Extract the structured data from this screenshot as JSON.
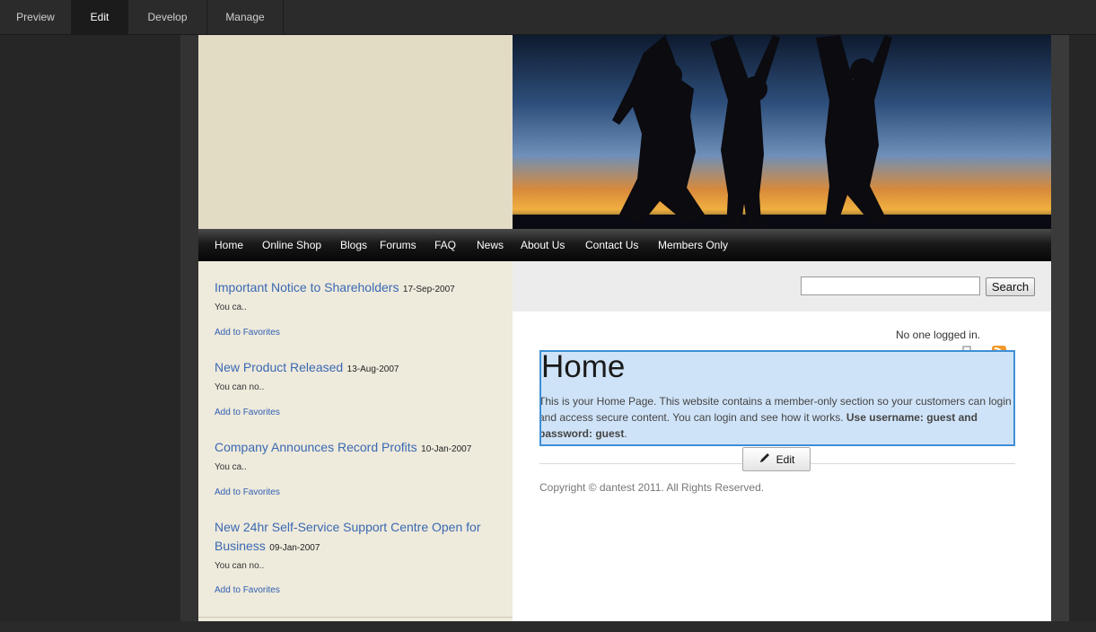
{
  "editor_tabs": [
    {
      "label": "Preview"
    },
    {
      "label": "Edit"
    },
    {
      "label": "Develop"
    },
    {
      "label": "Manage"
    }
  ],
  "nav": {
    "items": [
      {
        "label": "Home"
      },
      {
        "label": "Online Shop"
      },
      {
        "label": "Blogs"
      },
      {
        "label": "Forums"
      },
      {
        "label": "FAQ"
      },
      {
        "label": "News"
      },
      {
        "label": "About Us"
      },
      {
        "label": "Contact Us"
      },
      {
        "label": "Members Only"
      }
    ]
  },
  "news": [
    {
      "headline": "Important Notice to Shareholders",
      "date": "17-Sep-2007",
      "excerpt": "You ca..",
      "fav": "Add to Favorites"
    },
    {
      "headline": "New Product Released",
      "date": "13-Aug-2007",
      "excerpt": "You can no..",
      "fav": "Add to Favorites"
    },
    {
      "headline": "Company Announces Record Profits",
      "date": "10-Jan-2007",
      "excerpt": "You ca..",
      "fav": "Add to Favorites"
    },
    {
      "headline": "New 24hr Self-Service Support Centre Open for Business",
      "date": "09-Jan-2007",
      "excerpt": "You can no..",
      "fav": "Add to Favorites"
    }
  ],
  "search": {
    "value": "",
    "button_label": "Search"
  },
  "login_status": "No one logged in.",
  "content": {
    "title": "Home",
    "body_text": "This is your Home Page. This website contains a member-only section so your customers can login and access secure content. You can login and see how it works. ",
    "body_bold": "Use username: guest and password: guest",
    "body_end": "."
  },
  "edit_button": {
    "label": "Edit"
  },
  "footer": {
    "copyright": "Copyright © dantest 2011. All Rights Reserved."
  },
  "icons": [
    "print-icon",
    "rss-icon",
    "pencil-icon"
  ],
  "colors": {
    "link": "#3a69b2",
    "selection": "#cfe3f8",
    "selection_border": "#3d8fd6"
  }
}
